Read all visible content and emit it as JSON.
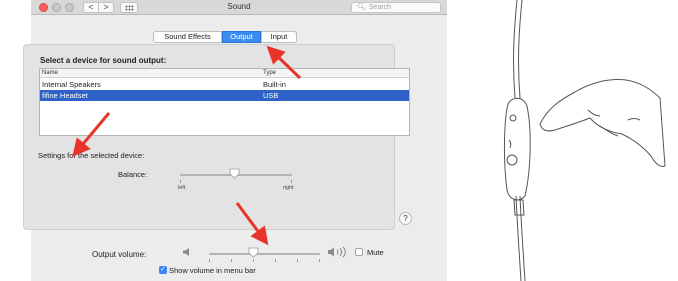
{
  "window": {
    "title": "Sound",
    "search_placeholder": "Search",
    "nav_back": "<",
    "nav_forward": ">"
  },
  "tabs": [
    {
      "label": "Sound Effects",
      "selected": false
    },
    {
      "label": "Output",
      "selected": true
    },
    {
      "label": "Input",
      "selected": false
    }
  ],
  "device_section": {
    "heading": "Select a device for sound output:",
    "columns": [
      "Name",
      "Type"
    ],
    "rows": [
      {
        "name": "Internal Speakers",
        "type": "Built-in",
        "selected": false
      },
      {
        "name": "fifine Headset",
        "type": "USB",
        "selected": true
      }
    ]
  },
  "settings": {
    "heading": "Settings for the selected device:",
    "balance_label": "Balance:",
    "balance_left": "left",
    "balance_right": "right",
    "balance_value": 0.5,
    "help_label": "?"
  },
  "output_volume": {
    "label": "Output volume:",
    "mute_label": "Mute",
    "mute_checked": false,
    "volume_value": 0.35,
    "show_in_menu_bar_label": "Show volume in menu bar",
    "show_in_menu_bar_checked": true
  },
  "colors": {
    "selection": "#2e62c6",
    "accent": "#3c8cf0",
    "annotation_arrow": "#e8332a",
    "close_button": "#fc605c"
  },
  "icons": {
    "search": "magnifier-icon",
    "volume_low": "speaker-low-icon",
    "volume_high": "speaker-high-icon",
    "help": "question-mark-icon"
  }
}
